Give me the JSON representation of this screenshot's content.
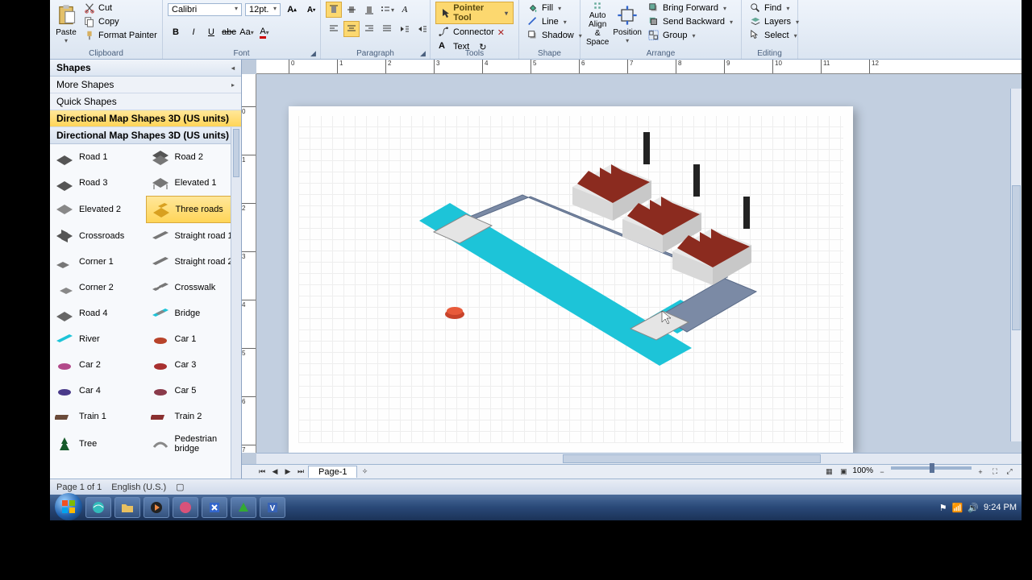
{
  "ribbon": {
    "clipboard": {
      "label": "Clipboard",
      "paste": "Paste",
      "cut": "Cut",
      "copy": "Copy",
      "format_painter": "Format Painter"
    },
    "font": {
      "label": "Font",
      "family": "Calibri",
      "size": "12pt."
    },
    "paragraph": {
      "label": "Paragraph"
    },
    "tools": {
      "label": "Tools",
      "pointer": "Pointer Tool",
      "connector": "Connector",
      "text": "Text"
    },
    "shape": {
      "label": "Shape",
      "fill": "Fill",
      "line": "Line",
      "shadow": "Shadow"
    },
    "arrange": {
      "label": "Arrange",
      "auto_align": "Auto Align & Space",
      "position": "Position",
      "bring_forward": "Bring Forward",
      "send_backward": "Send Backward",
      "group": "Group"
    },
    "editing": {
      "label": "Editing",
      "find": "Find",
      "layers": "Layers",
      "select": "Select"
    }
  },
  "shapes_panel": {
    "title": "Shapes",
    "more_shapes": "More Shapes",
    "quick_shapes": "Quick Shapes",
    "selected_stencil": "Directional Map Shapes 3D (US units)",
    "stencil_header": "Directional Map Shapes 3D (US units)",
    "items": [
      {
        "label": "Road 1"
      },
      {
        "label": "Road 2"
      },
      {
        "label": "Road 3"
      },
      {
        "label": "Elevated 1"
      },
      {
        "label": "Elevated 2"
      },
      {
        "label": "Three roads",
        "selected": true
      },
      {
        "label": "Crossroads"
      },
      {
        "label": "Straight road 1"
      },
      {
        "label": "Corner 1"
      },
      {
        "label": "Straight road 2"
      },
      {
        "label": "Corner 2"
      },
      {
        "label": "Crosswalk"
      },
      {
        "label": "Road 4"
      },
      {
        "label": "Bridge"
      },
      {
        "label": "River"
      },
      {
        "label": "Car 1"
      },
      {
        "label": "Car 2"
      },
      {
        "label": "Car 3"
      },
      {
        "label": "Car 4"
      },
      {
        "label": "Car 5"
      },
      {
        "label": "Train 1"
      },
      {
        "label": "Train 2"
      },
      {
        "label": "Tree"
      },
      {
        "label": "Pedestrian bridge"
      }
    ]
  },
  "page_tabs": {
    "current": "Page-1"
  },
  "status": {
    "page_info": "Page 1 of 1",
    "language": "English (U.S.)",
    "zoom": "100%"
  },
  "tray": {
    "time": "9:24 PM"
  }
}
